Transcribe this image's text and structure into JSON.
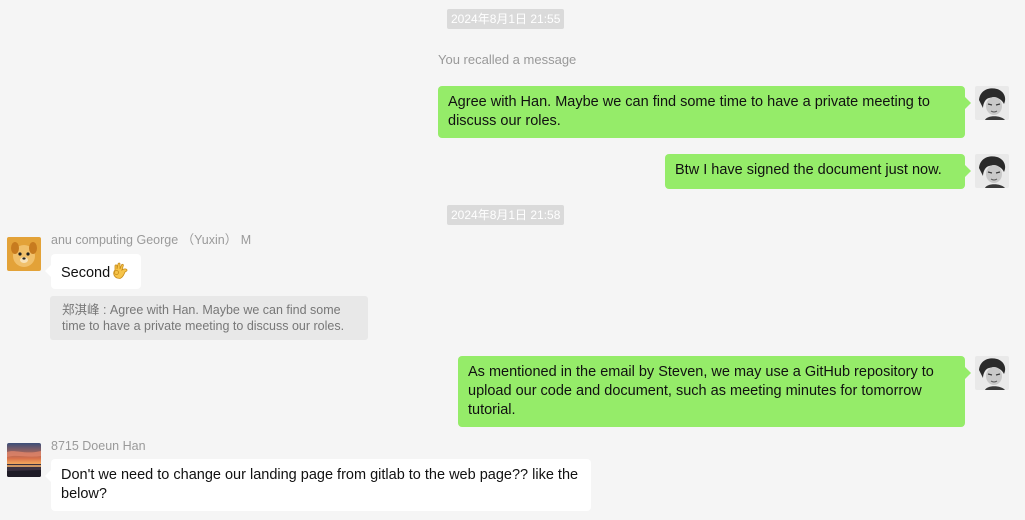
{
  "chat": {
    "timestamp_1": "2024年8月1日 21:55",
    "system_note": "You recalled a message",
    "messages_1": [
      {
        "sender": "self",
        "text": "Agree with Han. Maybe we can find some time to have a private meeting to discuss our roles."
      },
      {
        "sender": "self",
        "text": "Btw I have signed the document just now."
      }
    ],
    "timestamp_2": "2024年8月1日 21:58",
    "george": {
      "name": "anu computing George （Yuxin） M",
      "text": "Second",
      "emoji": "ok-hand-emoji",
      "quote": "郑淇峰 : Agree with Han. Maybe we can find some time to have a private meeting to discuss our roles."
    },
    "self_github": {
      "text": "As mentioned in the email by Steven, we may use a GitHub repository to upload our code and document, such as meeting minutes for tomorrow tutorial."
    },
    "han": {
      "name": "8715 Doeun Han",
      "text": "Don't we need to change our landing page from gitlab to the web page?? like the below?"
    }
  },
  "colors": {
    "background": "#f5f5f5",
    "self_bubble": "#95ec69",
    "other_bubble": "#ffffff",
    "timestamp_bg": "#dadada",
    "muted_text": "#999999"
  },
  "icons": {
    "self_avatar": "portrait-avatar",
    "george_avatar": "dog-avatar",
    "han_avatar": "sunset-avatar"
  }
}
